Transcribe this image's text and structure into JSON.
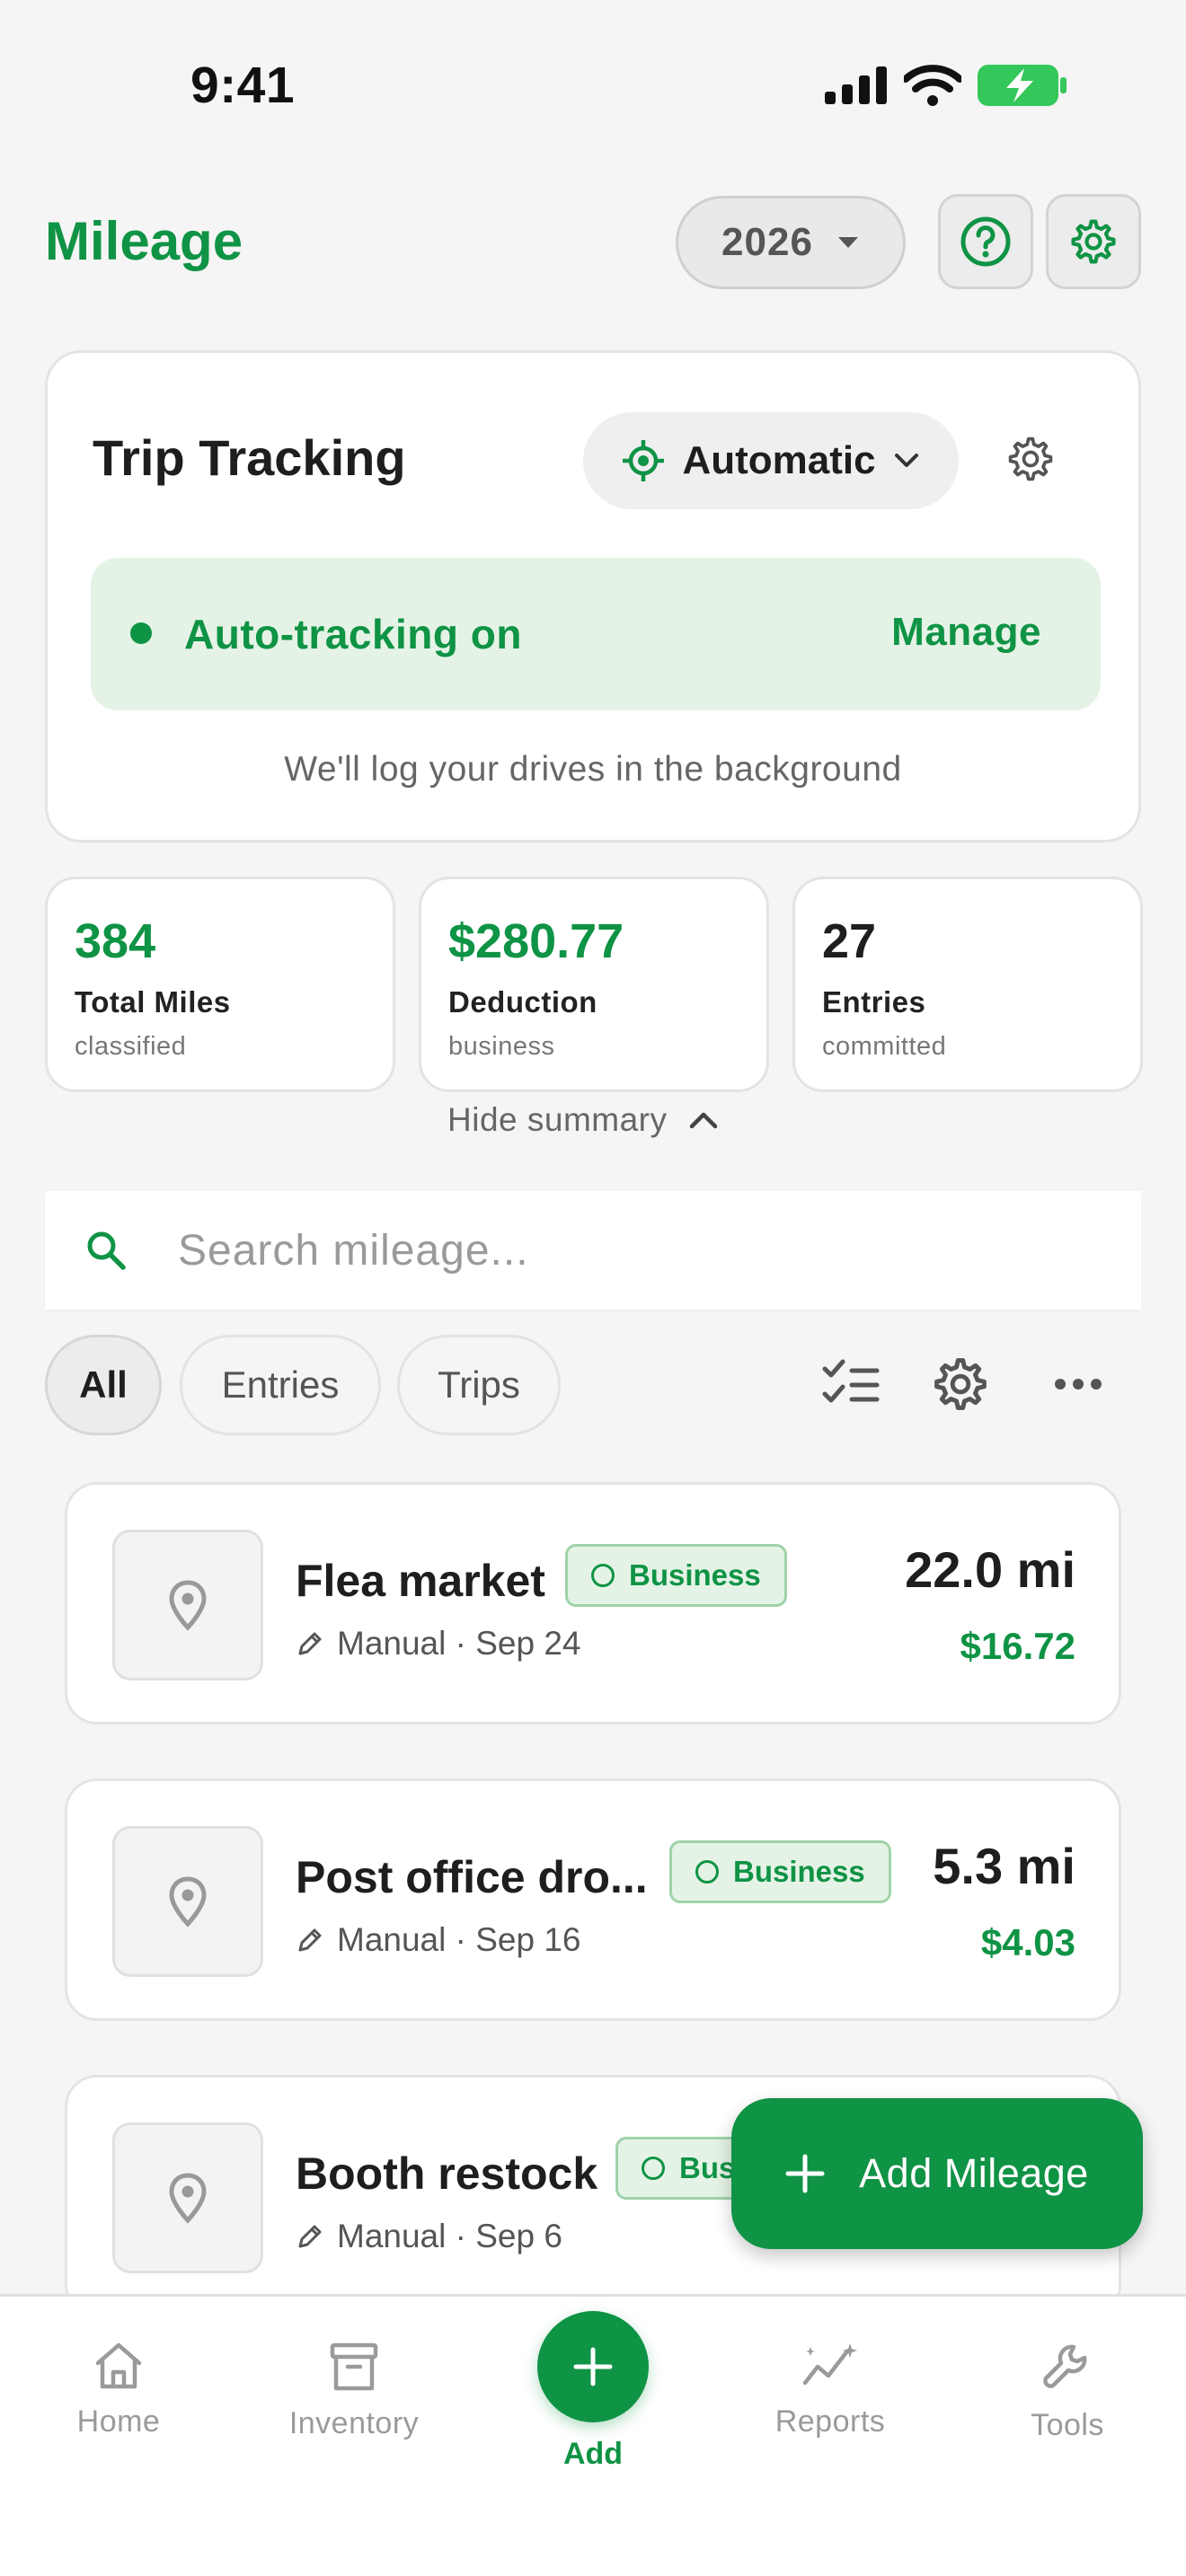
{
  "status_bar": {
    "time": "9:41"
  },
  "header": {
    "title": "Mileage",
    "year": "2026"
  },
  "trip_tracking": {
    "title": "Trip Tracking",
    "mode": "Automatic",
    "status": "Auto-tracking on",
    "manage": "Manage",
    "subtitle": "We'll log your drives in the background"
  },
  "stats": [
    {
      "value": "384",
      "label": "Total Miles",
      "sub": "classified",
      "color": "#0f9345"
    },
    {
      "value": "$280.77",
      "label": "Deduction",
      "sub": "business",
      "color": "#0f9345"
    },
    {
      "value": "27",
      "label": "Entries",
      "sub": "committed",
      "color": "#1e1e1e"
    }
  ],
  "hide_summary": "Hide summary",
  "search": {
    "placeholder": "Search mileage..."
  },
  "filters": [
    "All",
    "Entries",
    "Trips"
  ],
  "entries": [
    {
      "title": "Flea market",
      "badge": "Business",
      "meta": "Manual · Sep 24",
      "miles": "22.0 mi",
      "amount": "$16.72"
    },
    {
      "title": "Post office dro...",
      "badge": "Business",
      "meta": "Manual · Sep 16",
      "miles": "5.3 mi",
      "amount": "$4.03"
    },
    {
      "title": "Booth restock",
      "badge": "Bus",
      "meta": "Manual · Sep 6",
      "miles": "",
      "amount": ""
    }
  ],
  "fab": {
    "label": "Add Mileage"
  },
  "nav": {
    "home": "Home",
    "inventory": "Inventory",
    "add": "Add",
    "reports": "Reports",
    "tools": "Tools"
  },
  "colors": {
    "brand": "#0f9345",
    "badge_bg": "#e5f3e6"
  }
}
